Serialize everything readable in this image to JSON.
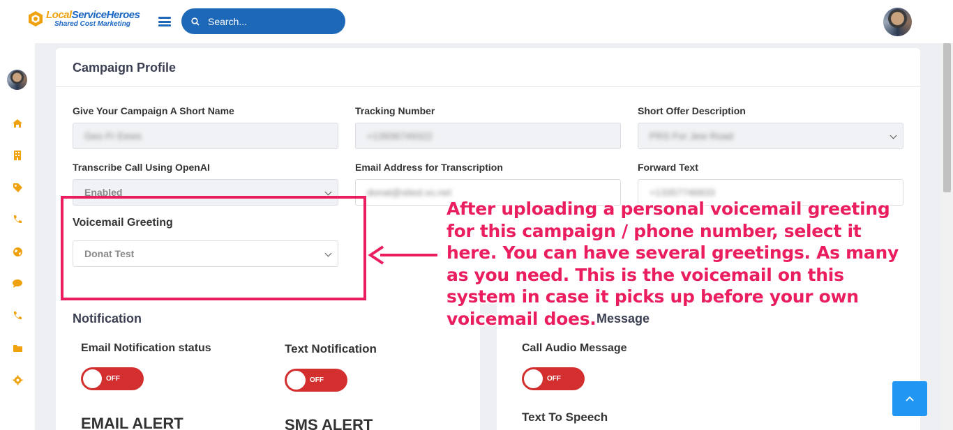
{
  "brand": {
    "name_part1": "Local",
    "name_part2": "ServiceHeroes",
    "tagline": "Shared Cost Marketing"
  },
  "search": {
    "placeholder": "Search..."
  },
  "sidebar": {
    "items": [
      "home-icon",
      "building-icon",
      "tag-icon",
      "phone-icon",
      "globe-icon",
      "chat-icon",
      "phone-icon",
      "folder-icon",
      "gear-icon"
    ]
  },
  "campaign": {
    "title": "Campaign Profile",
    "fields": {
      "short_name": {
        "label": "Give Your Campaign A Short Name",
        "value": "Geo Fr Eews"
      },
      "tracking": {
        "label": "Tracking Number",
        "value": "+13936749322"
      },
      "offer": {
        "label": "Short Offer Description",
        "value": "PRS For Jew Road"
      },
      "transcribe": {
        "label": "Transcribe Call Using OpenAI",
        "value": "Enabled"
      },
      "email": {
        "label": "Email Address for Transcription",
        "value": "donat@sited.vo.net"
      },
      "forward": {
        "label": "Forward Text",
        "value": "+13357746833"
      },
      "voicemail": {
        "label": "Voicemail Greeting",
        "value": "Donat Test"
      }
    }
  },
  "notification": {
    "title": "Notification",
    "email_status_label": "Email Notification status",
    "email_toggle": "OFF",
    "text_label": "Text Notification",
    "text_toggle": "OFF",
    "email_alert": "EMAIL ALERT",
    "sms_alert": "SMS ALERT"
  },
  "audio": {
    "title_partial": "Message",
    "call_audio_label": "Call Audio Message",
    "call_audio_toggle": "OFF",
    "tts_label": "Text To Speech"
  },
  "annotation": {
    "lines": [
      "After uploading a personal voicemail greeting",
      "for this campaign / phone number, select it",
      "here. You can have several greetings. As many",
      "as you need. This is the voicemail on this",
      "system in case it picks up before your own",
      "voicemail does."
    ]
  },
  "colors": {
    "accent": "#1e68b8",
    "annotation": "#ea1e5e",
    "toggle_off": "#d32f2f",
    "scroll_top": "#2196f3"
  }
}
